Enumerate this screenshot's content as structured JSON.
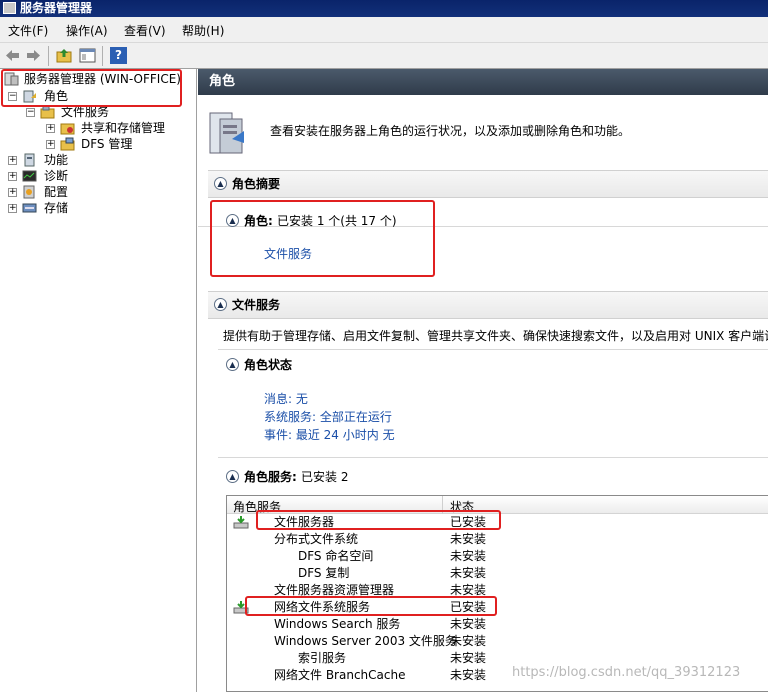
{
  "window": {
    "title": "服务器管理器"
  },
  "menu": [
    "文件(F)",
    "操作(A)",
    "查看(V)",
    "帮助(H)"
  ],
  "toolbar": {
    "help_label": "?"
  },
  "tree": {
    "root": "服务器管理器 (WIN-OFFICE)",
    "roles": "角色",
    "file_services": "文件服务",
    "share_storage": "共享和存储管理",
    "dfs_mgmt": "DFS 管理",
    "features": "功能",
    "diagnostics": "诊断",
    "configuration": "配置",
    "storage": "存储"
  },
  "pane": {
    "header": "角色",
    "intro_text": "查看安装在服务器上角色的运行状况，以及添加或删除角色和功能。",
    "summary_title": "角色摘要",
    "roles_label": "角色:",
    "roles_count": "已安装 1 个(共 17 个)",
    "role_link": "文件服务",
    "file_services_title": "文件服务",
    "file_services_desc": "提供有助于管理存储、启用文件复制、管理共享文件夹、确保快速搜索文件，以及启用对 UNIX 客户端计",
    "role_status_title": "角色状态",
    "status_messages": "消息: 无",
    "status_services": "系统服务: 全部正在运行",
    "status_events": "事件: 最近 24 小时内 无",
    "role_services_label": "角色服务:",
    "role_services_count": "已安装 2"
  },
  "table": {
    "col_name": "角色服务",
    "col_state": "状态",
    "rows": [
      {
        "name": "文件服务器",
        "state": "已安装",
        "installed": true,
        "indent": 0
      },
      {
        "name": "分布式文件系统",
        "state": "未安装",
        "installed": false,
        "indent": 0
      },
      {
        "name": "DFS 命名空间",
        "state": "未安装",
        "installed": false,
        "indent": 1
      },
      {
        "name": "DFS 复制",
        "state": "未安装",
        "installed": false,
        "indent": 1
      },
      {
        "name": "文件服务器资源管理器",
        "state": "未安装",
        "installed": false,
        "indent": 0
      },
      {
        "name": "网络文件系统服务",
        "state": "已安装",
        "installed": true,
        "indent": 0
      },
      {
        "name": "Windows Search 服务",
        "state": "未安装",
        "installed": false,
        "indent": 0
      },
      {
        "name": "Windows Server 2003 文件服务",
        "state": "未安装",
        "installed": false,
        "indent": 0
      },
      {
        "name": "索引服务",
        "state": "未安装",
        "installed": false,
        "indent": 1
      },
      {
        "name": "网络文件 BranchCache",
        "state": "未安装",
        "installed": false,
        "indent": 0
      }
    ]
  },
  "watermark": "https://blog.csdn.net/qq_39312123",
  "colors": {
    "highlight": "#e02020",
    "link": "#1b4fa8",
    "header_bg": "#3b4858"
  }
}
